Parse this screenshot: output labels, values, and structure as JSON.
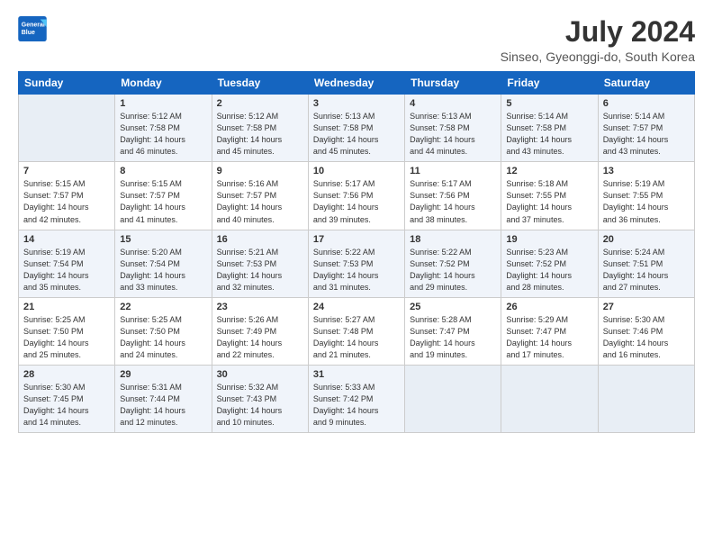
{
  "header": {
    "logo_line1": "General",
    "logo_line2": "Blue",
    "title": "July 2024",
    "subtitle": "Sinseo, Gyeonggi-do, South Korea"
  },
  "weekdays": [
    "Sunday",
    "Monday",
    "Tuesday",
    "Wednesday",
    "Thursday",
    "Friday",
    "Saturday"
  ],
  "weeks": [
    [
      {
        "day": "",
        "info": ""
      },
      {
        "day": "1",
        "info": "Sunrise: 5:12 AM\nSunset: 7:58 PM\nDaylight: 14 hours\nand 46 minutes."
      },
      {
        "day": "2",
        "info": "Sunrise: 5:12 AM\nSunset: 7:58 PM\nDaylight: 14 hours\nand 45 minutes."
      },
      {
        "day": "3",
        "info": "Sunrise: 5:13 AM\nSunset: 7:58 PM\nDaylight: 14 hours\nand 45 minutes."
      },
      {
        "day": "4",
        "info": "Sunrise: 5:13 AM\nSunset: 7:58 PM\nDaylight: 14 hours\nand 44 minutes."
      },
      {
        "day": "5",
        "info": "Sunrise: 5:14 AM\nSunset: 7:58 PM\nDaylight: 14 hours\nand 43 minutes."
      },
      {
        "day": "6",
        "info": "Sunrise: 5:14 AM\nSunset: 7:57 PM\nDaylight: 14 hours\nand 43 minutes."
      }
    ],
    [
      {
        "day": "7",
        "info": "Sunrise: 5:15 AM\nSunset: 7:57 PM\nDaylight: 14 hours\nand 42 minutes."
      },
      {
        "day": "8",
        "info": "Sunrise: 5:15 AM\nSunset: 7:57 PM\nDaylight: 14 hours\nand 41 minutes."
      },
      {
        "day": "9",
        "info": "Sunrise: 5:16 AM\nSunset: 7:57 PM\nDaylight: 14 hours\nand 40 minutes."
      },
      {
        "day": "10",
        "info": "Sunrise: 5:17 AM\nSunset: 7:56 PM\nDaylight: 14 hours\nand 39 minutes."
      },
      {
        "day": "11",
        "info": "Sunrise: 5:17 AM\nSunset: 7:56 PM\nDaylight: 14 hours\nand 38 minutes."
      },
      {
        "day": "12",
        "info": "Sunrise: 5:18 AM\nSunset: 7:55 PM\nDaylight: 14 hours\nand 37 minutes."
      },
      {
        "day": "13",
        "info": "Sunrise: 5:19 AM\nSunset: 7:55 PM\nDaylight: 14 hours\nand 36 minutes."
      }
    ],
    [
      {
        "day": "14",
        "info": "Sunrise: 5:19 AM\nSunset: 7:54 PM\nDaylight: 14 hours\nand 35 minutes."
      },
      {
        "day": "15",
        "info": "Sunrise: 5:20 AM\nSunset: 7:54 PM\nDaylight: 14 hours\nand 33 minutes."
      },
      {
        "day": "16",
        "info": "Sunrise: 5:21 AM\nSunset: 7:53 PM\nDaylight: 14 hours\nand 32 minutes."
      },
      {
        "day": "17",
        "info": "Sunrise: 5:22 AM\nSunset: 7:53 PM\nDaylight: 14 hours\nand 31 minutes."
      },
      {
        "day": "18",
        "info": "Sunrise: 5:22 AM\nSunset: 7:52 PM\nDaylight: 14 hours\nand 29 minutes."
      },
      {
        "day": "19",
        "info": "Sunrise: 5:23 AM\nSunset: 7:52 PM\nDaylight: 14 hours\nand 28 minutes."
      },
      {
        "day": "20",
        "info": "Sunrise: 5:24 AM\nSunset: 7:51 PM\nDaylight: 14 hours\nand 27 minutes."
      }
    ],
    [
      {
        "day": "21",
        "info": "Sunrise: 5:25 AM\nSunset: 7:50 PM\nDaylight: 14 hours\nand 25 minutes."
      },
      {
        "day": "22",
        "info": "Sunrise: 5:25 AM\nSunset: 7:50 PM\nDaylight: 14 hours\nand 24 minutes."
      },
      {
        "day": "23",
        "info": "Sunrise: 5:26 AM\nSunset: 7:49 PM\nDaylight: 14 hours\nand 22 minutes."
      },
      {
        "day": "24",
        "info": "Sunrise: 5:27 AM\nSunset: 7:48 PM\nDaylight: 14 hours\nand 21 minutes."
      },
      {
        "day": "25",
        "info": "Sunrise: 5:28 AM\nSunset: 7:47 PM\nDaylight: 14 hours\nand 19 minutes."
      },
      {
        "day": "26",
        "info": "Sunrise: 5:29 AM\nSunset: 7:47 PM\nDaylight: 14 hours\nand 17 minutes."
      },
      {
        "day": "27",
        "info": "Sunrise: 5:30 AM\nSunset: 7:46 PM\nDaylight: 14 hours\nand 16 minutes."
      }
    ],
    [
      {
        "day": "28",
        "info": "Sunrise: 5:30 AM\nSunset: 7:45 PM\nDaylight: 14 hours\nand 14 minutes."
      },
      {
        "day": "29",
        "info": "Sunrise: 5:31 AM\nSunset: 7:44 PM\nDaylight: 14 hours\nand 12 minutes."
      },
      {
        "day": "30",
        "info": "Sunrise: 5:32 AM\nSunset: 7:43 PM\nDaylight: 14 hours\nand 10 minutes."
      },
      {
        "day": "31",
        "info": "Sunrise: 5:33 AM\nSunset: 7:42 PM\nDaylight: 14 hours\nand 9 minutes."
      },
      {
        "day": "",
        "info": ""
      },
      {
        "day": "",
        "info": ""
      },
      {
        "day": "",
        "info": ""
      }
    ]
  ]
}
